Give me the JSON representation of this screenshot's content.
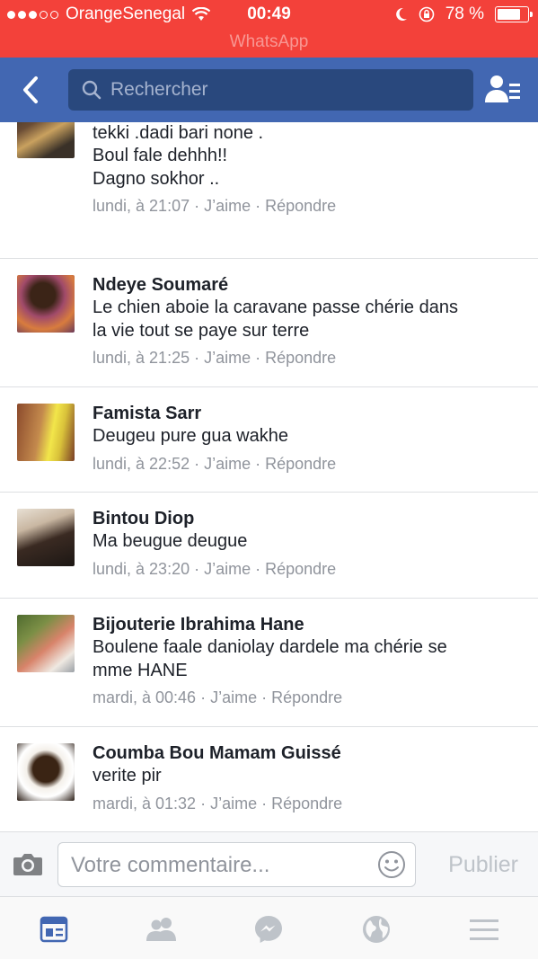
{
  "status_bar": {
    "carrier": "OrangeSenegal",
    "time": "00:49",
    "battery": "78 %",
    "battery_level": 0.78,
    "back_app": "WhatsApp"
  },
  "nav": {
    "search_placeholder": "Rechercher",
    "color": "#4267b2"
  },
  "comments": [
    {
      "author": "",
      "text": "Ma fille .boul soneu deh !! Kou bakh .mba ga\ntekki .dadi bari none .\nBoul fale dehhh!!\nDagno sokhor ..",
      "time": "lundi, à 21:07",
      "like": "J’aime",
      "reply": "Répondre"
    },
    {
      "author": "Ndeye Soumaré",
      "text": "Le chien aboie la caravane passe chérie dans\nla vie tout se paye sur terre",
      "time": "lundi, à 21:25",
      "like": "J’aime",
      "reply": "Répondre"
    },
    {
      "author": "Famista Sarr",
      "text": "Deugeu pure gua wakhe",
      "time": "lundi, à 22:52",
      "like": "J’aime",
      "reply": "Répondre"
    },
    {
      "author": "Bintou Diop",
      "text": "Ma beugue deugue",
      "time": "lundi, à 23:20",
      "like": "J’aime",
      "reply": "Répondre"
    },
    {
      "author": "Bijouterie Ibrahima Hane",
      "text": "Boulene faale daniolay dardele ma chérie se\nmme HANE",
      "time": "mardi, à 00:46",
      "like": "J’aime",
      "reply": "Répondre"
    },
    {
      "author": "Coumba Bou Mamam Guissé",
      "text": "verite pir",
      "time": "mardi, à 01:32",
      "like": "J’aime",
      "reply": "Répondre"
    }
  ],
  "composer": {
    "placeholder": "Votre commentaire...",
    "publish_label": "Publier"
  },
  "tabs": [
    {
      "icon": "news-feed-icon",
      "active": true
    },
    {
      "icon": "friends-icon",
      "active": false
    },
    {
      "icon": "messenger-icon",
      "active": false
    },
    {
      "icon": "globe-icon",
      "active": false
    },
    {
      "icon": "menu-icon",
      "active": false
    }
  ],
  "colors": {
    "status_bar": "#f3413a",
    "nav": "#4267b2",
    "meta": "#90949c",
    "tab_active": "#4267b2",
    "tab_inactive": "#bec3c9"
  }
}
